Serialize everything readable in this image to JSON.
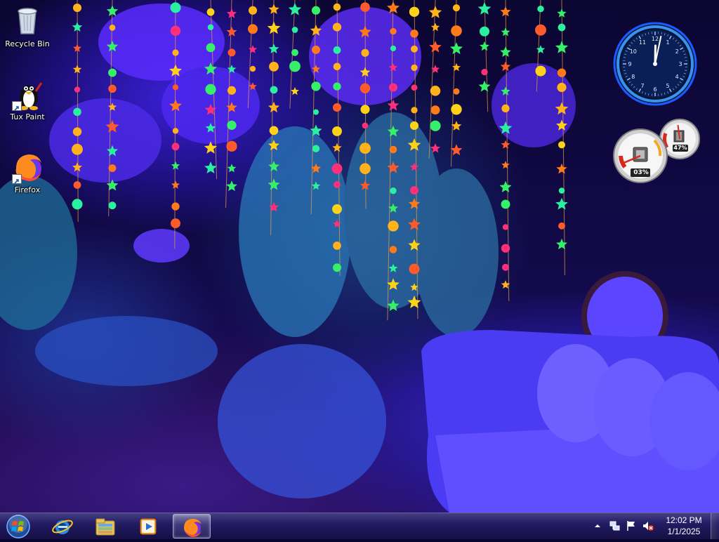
{
  "desktop": {
    "icons": [
      {
        "label": "Recycle Bin",
        "icon": "recycle-bin-icon"
      },
      {
        "label": "Tux Paint",
        "icon": "tux-paint-icon"
      },
      {
        "label": "Firefox",
        "icon": "firefox-icon"
      }
    ]
  },
  "gadgets": {
    "clock": {
      "hour": 12,
      "minute": 2,
      "numerals": [
        "12",
        "1",
        "2",
        "3",
        "4",
        "5",
        "6",
        "7",
        "8",
        "9",
        "10",
        "11"
      ]
    },
    "cpu_meter": {
      "cpu_label": "03%",
      "ram_label": "47%",
      "cpu_percent": 3,
      "ram_percent": 47
    }
  },
  "taskbar": {
    "start": {
      "icon": "windows-start-orb-icon"
    },
    "pinned": [
      {
        "name": "internet-explorer",
        "icon": "internet-explorer-icon"
      },
      {
        "name": "windows-explorer",
        "icon": "folder-library-icon"
      },
      {
        "name": "windows-media-player",
        "icon": "media-player-icon"
      },
      {
        "name": "firefox",
        "icon": "firefox-icon",
        "active": true
      }
    ],
    "tray": {
      "icons": [
        "show-hidden-icons-chevron",
        "network-icon",
        "action-center-flag-icon",
        "volume-muted-icon"
      ],
      "time": "12:02 PM",
      "date": "1/1/2025"
    }
  },
  "colors": {
    "clock_ring": "#2a7bff",
    "meter_red": "#d8281e",
    "taskbar": "#1c1450"
  }
}
